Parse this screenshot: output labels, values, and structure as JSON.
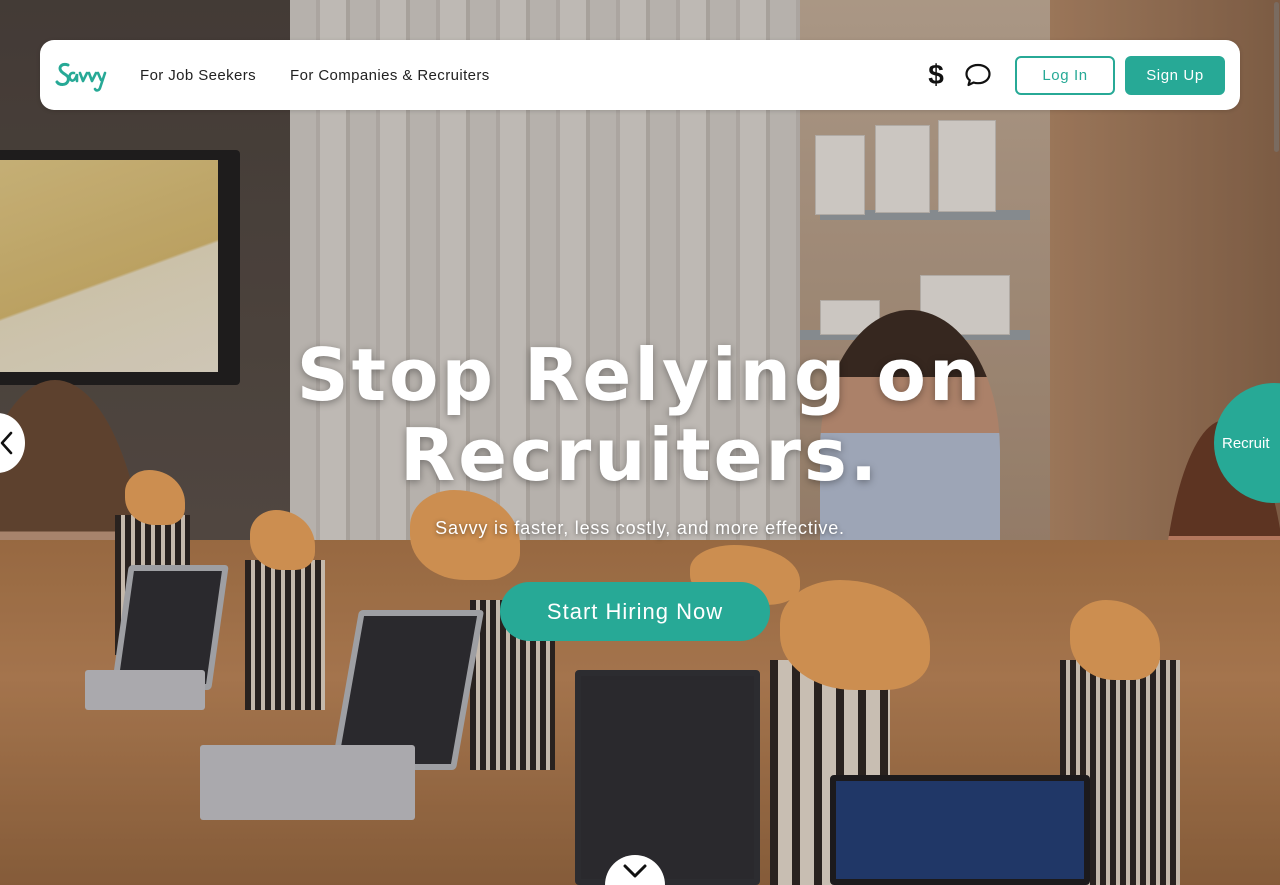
{
  "brand": {
    "logo_text": "Savvy",
    "accent": "#27a996"
  },
  "nav": {
    "links": [
      {
        "label": "For Job Seekers"
      },
      {
        "label": "For Companies & Recruiters"
      }
    ],
    "pricing_icon": "dollar-icon",
    "chat_icon": "chat-bubble-icon",
    "login_label": "Log In",
    "signup_label": "Sign Up"
  },
  "hero": {
    "headline_line1": "Stop Relying on",
    "headline_line2": "Recruiters.",
    "subheadline": "Savvy is faster, less costly, and more effective.",
    "cta_label": "Start Hiring Now",
    "side_tab_label": "Recruit",
    "prev_icon": "chevron-left-icon",
    "scroll_icon": "chevron-down-icon"
  }
}
